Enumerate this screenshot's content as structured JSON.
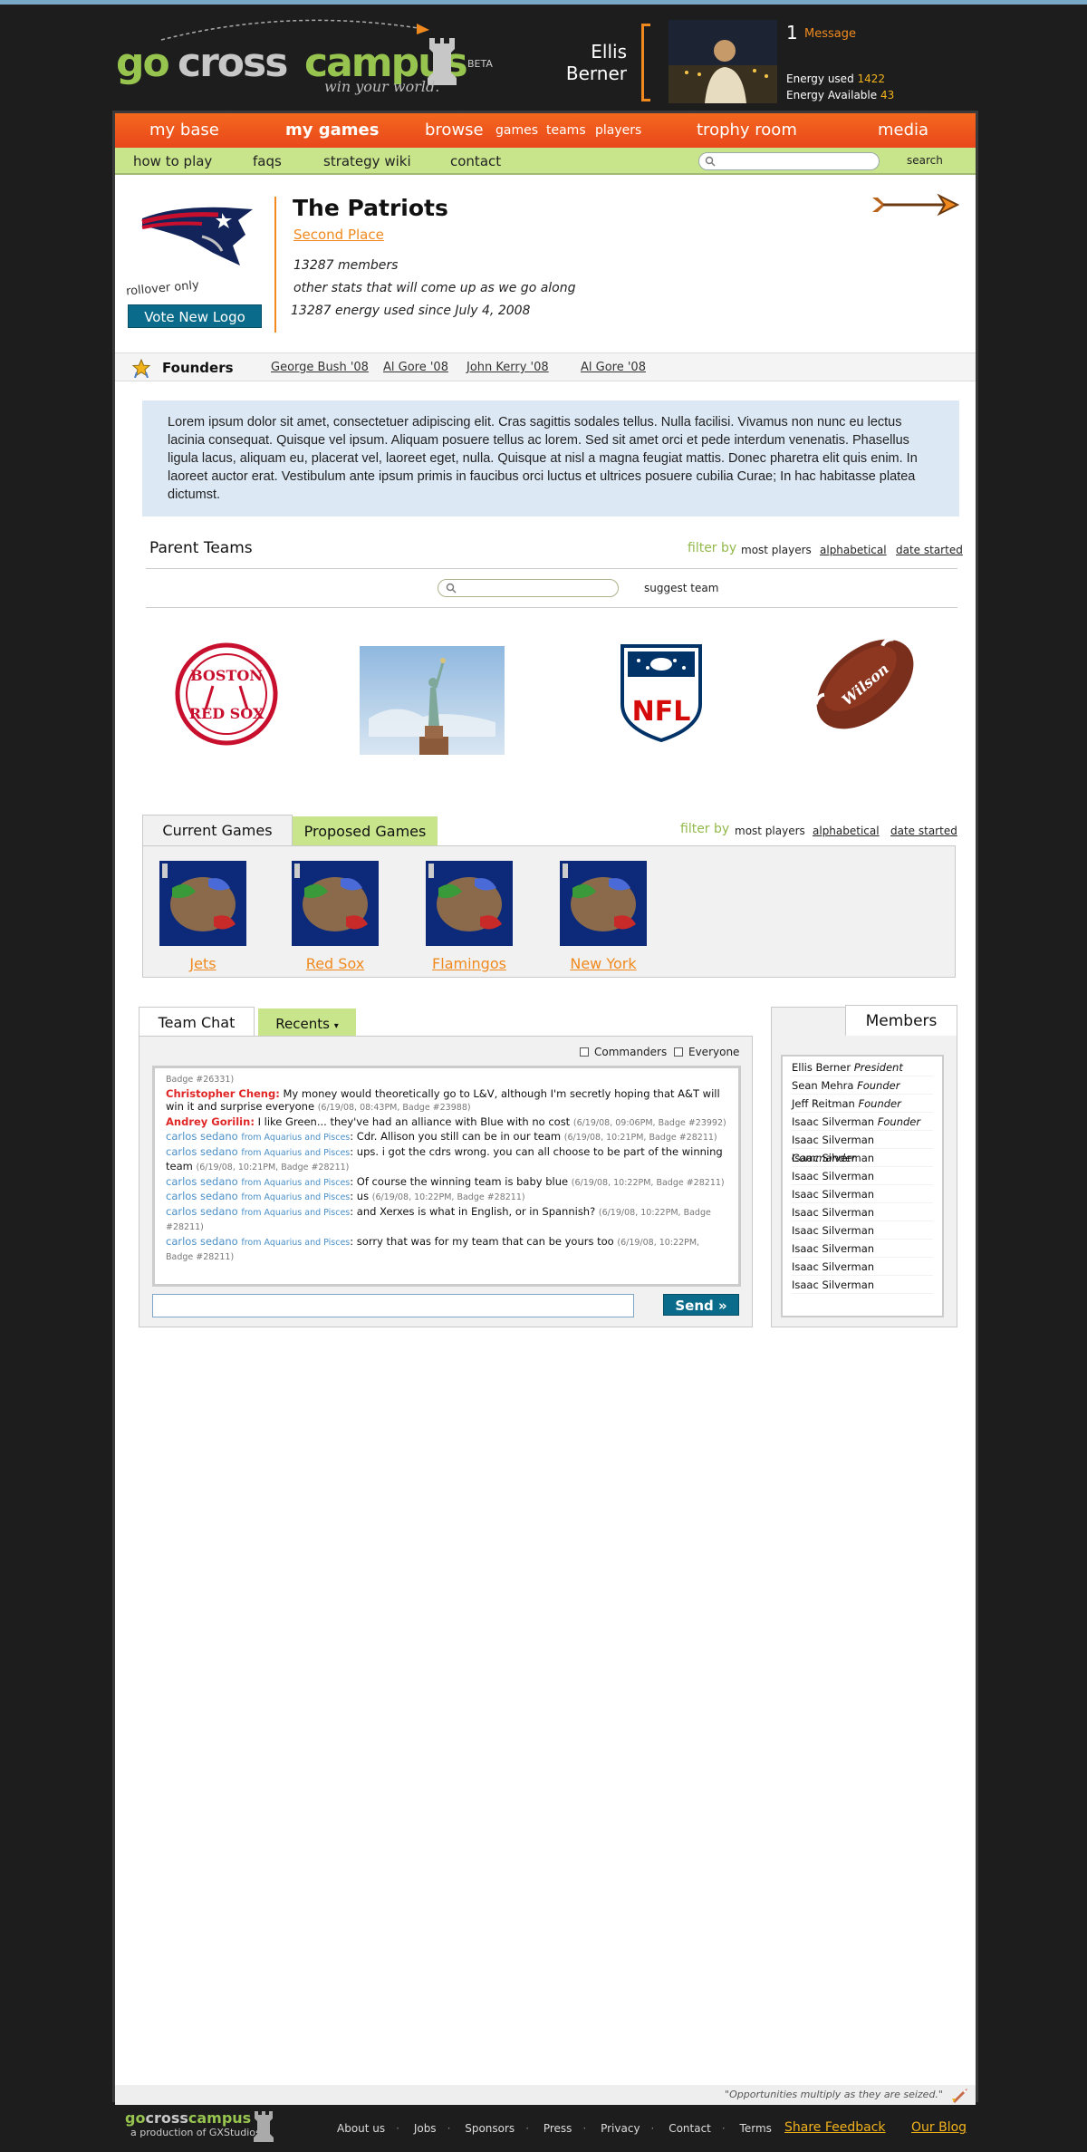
{
  "header": {
    "logo": {
      "go": "go",
      "cross": "cross",
      "campus": "campus",
      "tagline": "win your world.",
      "beta": "BETA"
    },
    "user": {
      "first_name": "Ellis",
      "last_name": "Berner",
      "message_count": "1",
      "message_label": "Message",
      "energy_used_label": "Energy used",
      "energy_used": "1422",
      "energy_available_label": "Energy Available",
      "energy_available": "43"
    }
  },
  "nav": {
    "main": {
      "my_base": "my base",
      "my_games": "my games",
      "browse": "browse",
      "games": "games",
      "teams": "teams",
      "players": "players",
      "trophy_room": "trophy room",
      "media": "media"
    },
    "sub": {
      "how_to_play": "how to play",
      "faqs": "faqs",
      "strategy_wiki": "strategy wiki",
      "contact": "contact",
      "search_button": "search",
      "search_placeholder": ""
    }
  },
  "team": {
    "rollover": "rollover only",
    "vote_button": "Vote New Logo",
    "name": "The Patriots",
    "place": "Second Place",
    "members": "13287 members",
    "other_stats": "other stats that will come up as we go along",
    "energy": "13287 energy used  since July 4, 2008"
  },
  "founders": {
    "label": "Founders",
    "items": [
      "George Bush '08",
      "Al Gore '08",
      "John Kerry '08",
      "Al Gore '08"
    ]
  },
  "description": "Lorem ipsum dolor sit amet, consectetuer adipiscing elit. Cras sagittis sodales tellus. Nulla facilisi. Vivamus non nunc eu lectus lacinia consequat. Quisque vel ipsum. Aliquam posuere tellus ac lorem. Sed sit amet orci et pede interdum venenatis. Phasellus ligula lacus, aliquam eu, placerat vel, laoreet eget, nulla. Quisque at nisl a magna feugiat mattis. Donec pharetra elit quis enim. In laoreet auctor erat. Vestibulum ante ipsum primis in faucibus orci luctus et ultrices posuere cubilia Curae; In hac habitasse platea dictumst.",
  "parent_teams": {
    "title": "Parent Teams",
    "filter_label": "filter by",
    "filters": [
      "most players",
      "alphabetical",
      "date started"
    ],
    "suggest": "suggest team",
    "items": [
      {
        "icon": "red-sox-logo",
        "top_text": "BOSTON",
        "bottom_text": "RED SOX"
      },
      {
        "icon": "statue-of-liberty-photo"
      },
      {
        "icon": "nfl-logo",
        "text": "NFL"
      },
      {
        "icon": "football-photo",
        "text": "Wilson"
      }
    ]
  },
  "games": {
    "tab_current": "Current Games",
    "tab_proposed": "Proposed Games",
    "filter_label": "filter by",
    "filters": [
      "most players",
      "alphabetical",
      "date started"
    ],
    "items": [
      "Jets",
      "Red Sox",
      "Flamingos",
      "New York"
    ]
  },
  "chat": {
    "tab_chat": "Team Chat",
    "tab_recents": "Recents",
    "opt_commanders": "Commanders",
    "opt_everyone": "Everyone",
    "send": "Send »",
    "messages": [
      {
        "pre_meta": "Badge #26331)"
      },
      {
        "user": "Christopher Cheng",
        "style": "red",
        "text": "My money would theoretically go to L&V, although I'm secretly hoping that A&T will win it and surprise everyone",
        "meta": "(6/19/08, 08:43PM, Badge #23988)"
      },
      {
        "user": "Andrey Gorilin",
        "style": "red",
        "text": "I like Green... they've had an alliance with Blue with no cost",
        "meta": "(6/19/08, 09:06PM, Badge #23992)"
      },
      {
        "user": "carlos sedano",
        "from": "from Aquarius and Pisces",
        "style": "blue",
        "text": "Cdr. Allison you still can be in our team",
        "meta": "(6/19/08, 10:21PM, Badge #28211)"
      },
      {
        "user": "carlos sedano",
        "from": "from Aquarius and Pisces",
        "style": "blue",
        "text": "ups. i got the cdrs wrong. you can all choose to be part of the winning team",
        "meta": "(6/19/08, 10:21PM, Badge #28211)"
      },
      {
        "user": "carlos sedano",
        "from": "from Aquarius and Pisces",
        "style": "blue",
        "text": "Of course the winning team is baby blue",
        "meta": "(6/19/08, 10:22PM, Badge #28211)"
      },
      {
        "user": "carlos sedano",
        "from": "from Aquarius and Pisces",
        "style": "blue",
        "text": "us",
        "meta": "(6/19/08, 10:22PM, Badge #28211)"
      },
      {
        "user": "carlos sedano",
        "from": "from Aquarius and Pisces",
        "style": "blue",
        "text": "and Xerxes is what in English, or in Spannish?",
        "meta": "(6/19/08, 10:22PM, Badge #28211)"
      },
      {
        "user": "carlos sedano",
        "from": "from Aquarius and Pisces",
        "style": "blue",
        "text": "sorry that was for my team that can be yours too",
        "meta": "(6/19/08, 10:22PM, Badge #28211)"
      }
    ]
  },
  "members": {
    "title": "Members",
    "items": [
      {
        "name": "Ellis Berner",
        "role": "President"
      },
      {
        "name": "Sean Mehra",
        "role": "Founder"
      },
      {
        "name": "Jeff Reitman",
        "role": "Founder"
      },
      {
        "name": "Isaac Silverman",
        "role": "Founder"
      },
      {
        "name": "Isaac Silverman",
        "role": "Commander"
      },
      {
        "name": "Isaac Silverman",
        "role": ""
      },
      {
        "name": "Isaac Silverman",
        "role": ""
      },
      {
        "name": "Isaac Silverman",
        "role": ""
      },
      {
        "name": "Isaac Silverman",
        "role": ""
      },
      {
        "name": "Isaac Silverman",
        "role": ""
      },
      {
        "name": "Isaac Silverman",
        "role": ""
      },
      {
        "name": "Isaac Silverman",
        "role": ""
      },
      {
        "name": "Isaac Silverman",
        "role": ""
      }
    ]
  },
  "quote": "\"Opportunities multiply as they are seized.\"",
  "footer": {
    "logo_go": "go",
    "logo_cross": "cross",
    "logo_campus": "campus",
    "production": "a production of GXStudios",
    "links": [
      "About us",
      "Jobs",
      "Sponsors",
      "Press",
      "Privacy",
      "Contact",
      "Terms"
    ],
    "share_feedback": "Share Feedback",
    "our_blog": "Our Blog"
  },
  "colors": {
    "orange": "#f08a1e",
    "green": "#97c44f",
    "nav_orange": "#f4681e",
    "nav_green": "#c8e58b",
    "button_teal": "#0b6b8a"
  }
}
